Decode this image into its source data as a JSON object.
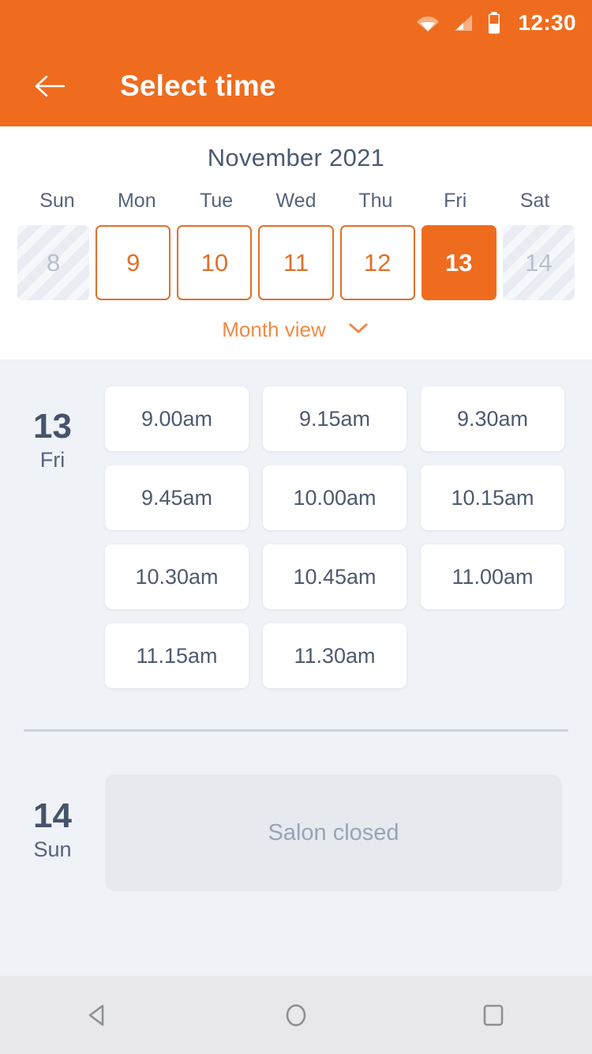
{
  "status_bar": {
    "time": "12:30",
    "icons": [
      "wifi-icon",
      "cellular-signal-icon",
      "battery-icon"
    ]
  },
  "app_bar": {
    "back_icon": "back-arrow-icon",
    "title": "Select time"
  },
  "calendar": {
    "month_title": "November 2021",
    "weekdays": [
      "Sun",
      "Mon",
      "Tue",
      "Wed",
      "Thu",
      "Fri",
      "Sat"
    ],
    "dates": [
      {
        "day": "8",
        "state": "disabled"
      },
      {
        "day": "9",
        "state": "available"
      },
      {
        "day": "10",
        "state": "available"
      },
      {
        "day": "11",
        "state": "available"
      },
      {
        "day": "12",
        "state": "available"
      },
      {
        "day": "13",
        "state": "selected"
      },
      {
        "day": "14",
        "state": "disabled"
      }
    ],
    "month_view_label": "Month view",
    "month_view_icon": "chevron-down-icon"
  },
  "schedule": [
    {
      "day_number": "13",
      "day_of_week": "Fri",
      "slots": [
        "9.00am",
        "9.15am",
        "9.30am",
        "9.45am",
        "10.00am",
        "10.15am",
        "10.30am",
        "10.45am",
        "11.00am",
        "11.15am",
        "11.30am"
      ]
    },
    {
      "day_number": "14",
      "day_of_week": "Sun",
      "closed_message": "Salon closed"
    }
  ],
  "nav_bar": {
    "back": "android-back-icon",
    "home": "android-home-icon",
    "recents": "android-recents-icon"
  },
  "colors": {
    "accent": "#ef6c1f",
    "accent_soft": "#e0702a",
    "body_bg": "#eff2f7",
    "card_bg": "#ffffff",
    "text_dark": "#46536b",
    "text_muted": "#9aa3b4",
    "closed_panel": "#e6eaef"
  }
}
